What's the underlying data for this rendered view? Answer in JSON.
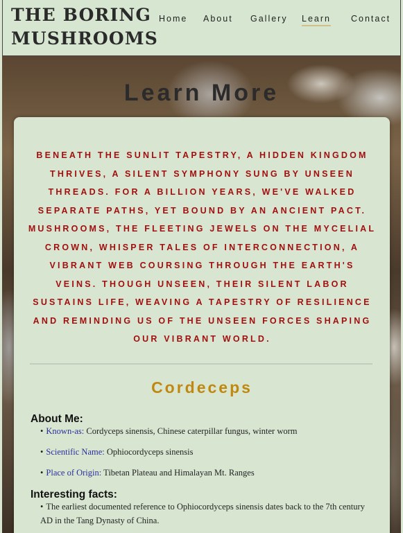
{
  "site": {
    "logo": "THE BORING\nMUSHROOMS"
  },
  "nav": {
    "items": [
      {
        "label": "Home"
      },
      {
        "label": "About"
      },
      {
        "label": "Gallery"
      },
      {
        "label": "Learn",
        "active": true
      },
      {
        "label": "Contact"
      }
    ]
  },
  "page": {
    "title": "Learn More",
    "intro": "Beneath the sunlit tapestry, a hidden kingdom thrives, a silent symphony sung by unseen threads. For a billion years, we've walked separate paths, yet bound by an ancient pact. Mushrooms, the fleeting jewels on the mycelial crown, whisper tales of interconnection, a vibrant web coursing through the earth's veins. Though unseen, their silent labor sustains life, weaving a tapestry of resilience and reminding us of the unseen forces shaping our vibrant world."
  },
  "species": {
    "name": "Cordeceps",
    "about_heading": "About Me:",
    "about": [
      {
        "key": "Known-as:",
        "value": " Cordyceps sinensis, Chinese caterpillar fungus, winter worm"
      },
      {
        "key": "Scientific Name:",
        "value": " Ophiocordyceps sinensis"
      },
      {
        "key": "Place of Origin:",
        "value": " Tibetan Plateau and Himalayan Mt. Ranges"
      }
    ],
    "facts_heading": "Interesting facts:",
    "facts": [
      "The earliest documented reference to Ophiocordyceps sinensis dates back to the 7th century AD in the Tang Dynasty of China."
    ]
  },
  "colors": {
    "header_bg": "#d6e6d0",
    "card_bg": "#d8e6d1",
    "intro_text": "#a10f0f",
    "species_title": "#c0880f",
    "key_text": "#2a2f9a"
  }
}
